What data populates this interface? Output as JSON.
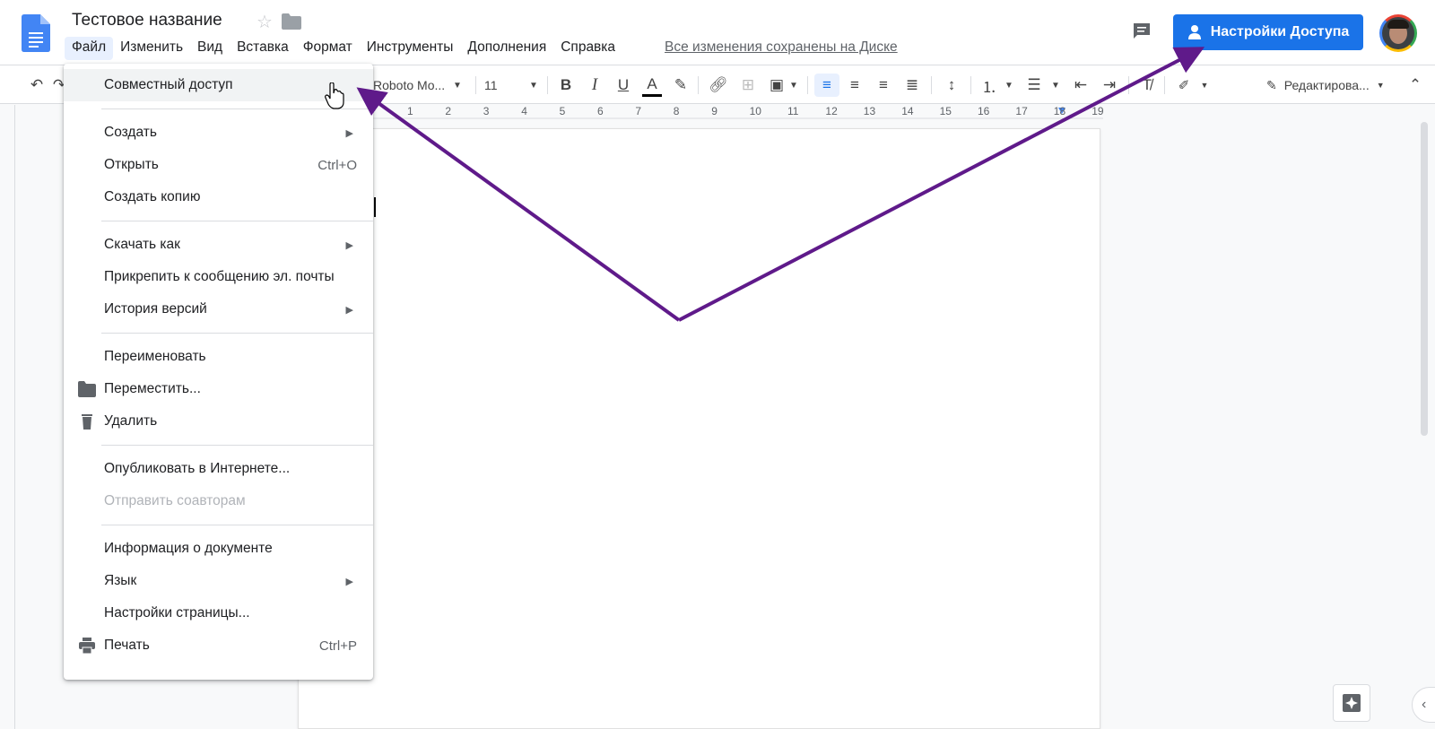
{
  "header": {
    "title": "Тестовое название",
    "saved_status": "Все изменения сохранены на Диске",
    "share_button_label": "Настройки Доступа"
  },
  "menubar": {
    "items": [
      "Файл",
      "Изменить",
      "Вид",
      "Вставка",
      "Формат",
      "Инструменты",
      "Дополнения",
      "Справка"
    ],
    "active": "Файл"
  },
  "toolbar": {
    "font": "Roboto Mo...",
    "font_size": "11",
    "mode": "Редактирова..."
  },
  "ruler": {
    "marks": [
      "1",
      "2",
      "3",
      "4",
      "5",
      "6",
      "7",
      "8",
      "9",
      "10",
      "11",
      "12",
      "13",
      "14",
      "15",
      "16",
      "17",
      "18",
      "19"
    ]
  },
  "file_menu": {
    "share": "Совместный доступ",
    "create": "Создать",
    "open": "Открыть",
    "open_shortcut": "Ctrl+O",
    "copy": "Создать копию",
    "download": "Скачать как",
    "email": "Прикрепить к сообщению эл. почты",
    "history": "История версий",
    "rename": "Переименовать",
    "move": "Переместить...",
    "delete": "Удалить",
    "publish": "Опубликовать в Интернете...",
    "send_collab": "Отправить соавторам",
    "doc_info": "Информация о документе",
    "language": "Язык",
    "page_setup": "Настройки страницы...",
    "print": "Печать",
    "print_shortcut": "Ctrl+P"
  },
  "colors": {
    "accent": "#1a73e8",
    "annotation_arrow": "#5f1a8a"
  }
}
